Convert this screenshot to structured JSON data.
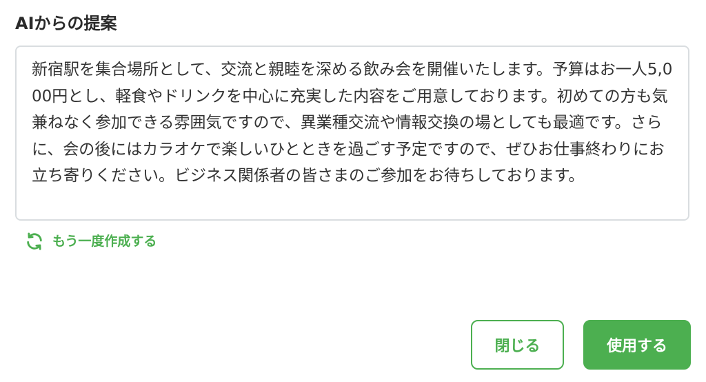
{
  "dialog": {
    "title": "AIからの提案",
    "suggestion_text": "新宿駅を集合場所として、交流と親睦を深める飲み会を開催いたします。予算はお一人5,000円とし、軽食やドリンクを中心に充実した内容をご用意しております。初めての方も気兼ねなく参加できる雰囲気ですので、異業種交流や情報交換の場としても最適です。さらに、会の後にはカラオケで楽しいひとときを過ごす予定ですので、ぜひお仕事終わりにお立ち寄りください。ビジネス関係者の皆さまのご参加をお待ちしております。",
    "regenerate_label": "もう一度作成する",
    "regenerate_icon": "refresh-icon",
    "close_label": "閉じる",
    "use_label": "使用する"
  },
  "colors": {
    "accent": "#4caf50",
    "border": "#d9dde0",
    "text": "#333333"
  }
}
